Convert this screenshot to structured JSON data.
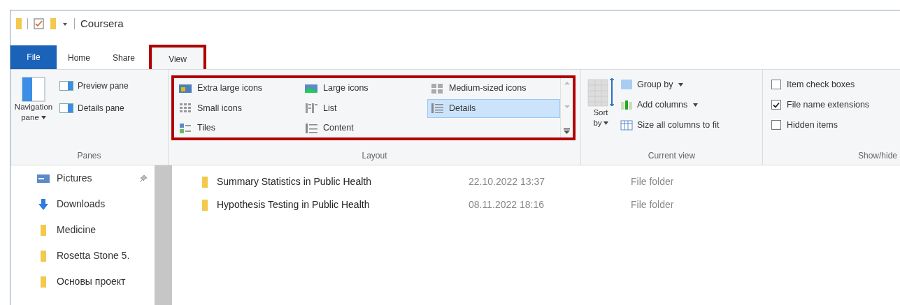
{
  "window": {
    "title": "Coursera"
  },
  "tabs": [
    {
      "label": "File",
      "kind": "file",
      "selected": false,
      "highlighted": false
    },
    {
      "label": "Home",
      "kind": "tab",
      "selected": false,
      "highlighted": false
    },
    {
      "label": "Share",
      "kind": "tab",
      "selected": false,
      "highlighted": false
    },
    {
      "label": "View",
      "kind": "tab",
      "selected": true,
      "highlighted": true
    }
  ],
  "ribbon": {
    "panes": {
      "label": "Panes",
      "navigation_pane": [
        "Navigation",
        "pane"
      ],
      "items": [
        "Preview pane",
        "Details pane"
      ]
    },
    "layout": {
      "label": "Layout",
      "highlighted": true,
      "items": [
        {
          "label": "Extra large icons",
          "selected": false
        },
        {
          "label": "Large icons",
          "selected": false
        },
        {
          "label": "Medium-sized icons",
          "selected": false
        },
        {
          "label": "Small icons",
          "selected": false
        },
        {
          "label": "List",
          "selected": false
        },
        {
          "label": "Details",
          "selected": true
        },
        {
          "label": "Tiles",
          "selected": false
        },
        {
          "label": "Content",
          "selected": false
        }
      ]
    },
    "current_view": {
      "label": "Current view",
      "sort_by": [
        "Sort",
        "by"
      ],
      "items": [
        "Group by",
        "Add columns",
        "Size all columns to fit"
      ]
    },
    "show_hide": {
      "label": "Show/hide",
      "items": [
        {
          "label": "Item check boxes",
          "checked": false
        },
        {
          "label": "File name extensions",
          "checked": true
        },
        {
          "label": "Hidden items",
          "checked": false
        }
      ]
    }
  },
  "sidebar": {
    "items": [
      {
        "label": "Pictures",
        "kind": "pictures",
        "pinned": true
      },
      {
        "label": "Downloads",
        "kind": "downloads",
        "pinned": false
      },
      {
        "label": "Medicine",
        "kind": "folder",
        "pinned": false
      },
      {
        "label": "Rosetta Stone 5.",
        "kind": "folder",
        "pinned": false
      },
      {
        "label": "Основы проект",
        "kind": "folder",
        "pinned": false
      }
    ]
  },
  "files": [
    {
      "name": "Summary Statistics in Public Health",
      "date": "22.10.2022 13:37",
      "type": "File folder"
    },
    {
      "name": "Hypothesis Testing in Public Health",
      "date": "08.11.2022 18:16",
      "type": "File folder"
    }
  ]
}
